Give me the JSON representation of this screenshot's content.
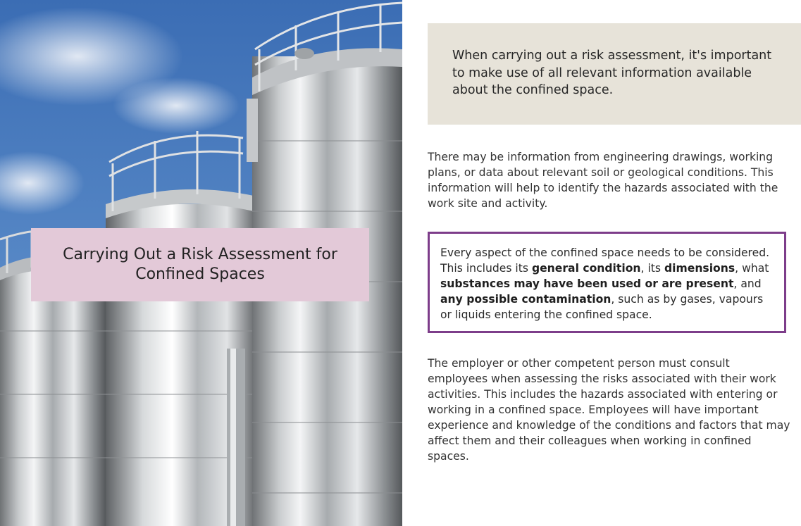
{
  "hero": {
    "image_description_icon": "steel-silos-image",
    "title_line_1": "Carrying Out a Risk Assessment for",
    "title_line_2": "Confined Spaces"
  },
  "intro": {
    "text": "When carrying out a risk assessment, it's important to make use of all relevant information available about the confined space."
  },
  "paragraph_1": "There may be information from engineering drawings, working plans, or data about relevant soil or geological conditions. This information will help to identify the hazards associated with the work site and activity.",
  "highlight": {
    "t1": "Every aspect of the confined space needs to be considered. This includes its ",
    "b1": "general condition",
    "t2": ", its ",
    "b2": "dimensions",
    "t3": ", what ",
    "b3": "substances may have been used or are present",
    "t4": ", and ",
    "b4": "any possible contamination",
    "t5": ", such as by gases, vapours or liquids entering the confined space."
  },
  "paragraph_2": "The employer or other competent person must consult employees when assessing the risks associated with their work activities. This includes the hazards associated with entering or working in a confined space. Employees will have important experience and knowledge of the conditions and factors that may affect them and their colleagues when working in confined spaces.",
  "colors": {
    "title_card": "#e3c9d8",
    "intro_box": "#e7e3d9",
    "highlight_border": "#7d3d8a"
  }
}
